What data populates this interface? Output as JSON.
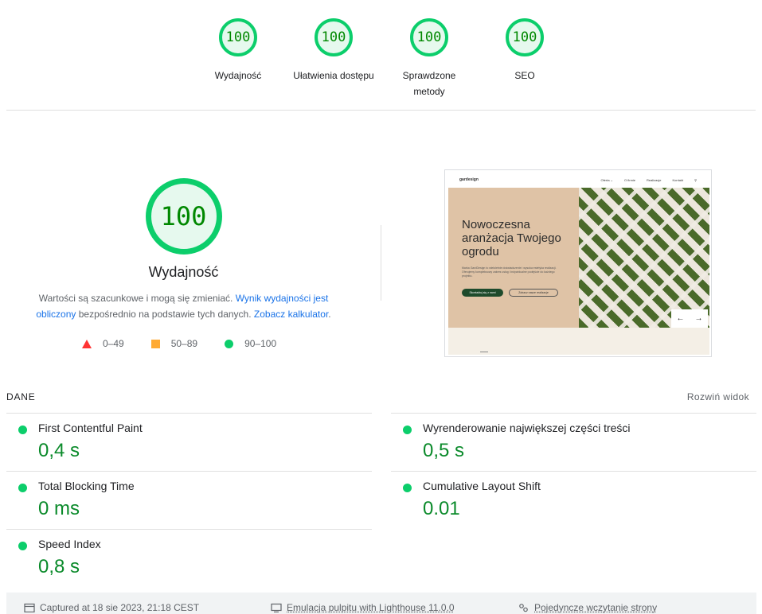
{
  "categories": [
    {
      "score": "100",
      "label": "Wydajność"
    },
    {
      "score": "100",
      "label": "Ułatwienia dostępu"
    },
    {
      "score": "100",
      "label": "Sprawdzone metody"
    },
    {
      "score": "100",
      "label": "SEO"
    }
  ],
  "performance": {
    "score": "100",
    "title": "Wydajność",
    "desc_part1": "Wartości są szacunkowe i mogą się zmieniać. ",
    "desc_link1": "Wynik wydajności jest obliczony",
    "desc_part2": " bezpośrednio na podstawie tych danych. ",
    "desc_link2": "Zobacz kalkulator",
    "desc_part3": "."
  },
  "legend": [
    {
      "shape": "triangle",
      "label": "0–49",
      "color": "#ff3333"
    },
    {
      "shape": "square",
      "label": "50–89",
      "color": "#ffaa33"
    },
    {
      "shape": "circle",
      "label": "90–100",
      "color": "#0cce6b"
    }
  ],
  "preview": {
    "logo": "gardesign",
    "menu": [
      "Oferta ⌄",
      "O firmie",
      "Realizacje",
      "Kontakt"
    ],
    "headline": "Nowoczesna aranżacja Twojego ogrodu",
    "paragraph": "Marka GardDesign to wieloletnie doświadczenie i wysoka estetyka realizacji. Oferujemy kompleksowy zakres usług i indywidualne podejście do każdego projektu.",
    "btn_primary": "Skontaktuj się z nami",
    "btn_secondary": "Zobacz nasze realizacje"
  },
  "metrics_section": {
    "title": "DANE",
    "expand_label": "Rozwiń widok"
  },
  "metrics": [
    {
      "name": "First Contentful Paint",
      "value": "0,4 s"
    },
    {
      "name": "Wyrenderowanie największej części treści",
      "value": "0,5 s"
    },
    {
      "name": "Total Blocking Time",
      "value": "0 ms"
    },
    {
      "name": "Cumulative Layout Shift",
      "value": "0.01"
    },
    {
      "name": "Speed Index",
      "value": "0,8 s"
    }
  ],
  "footer": {
    "captured": "Captured at 18 sie 2023, 21:18 CEST",
    "emulation": "Emulacja pulpitu with Lighthouse 11.0.0",
    "load": "Pojedyncze wczytanie strony"
  },
  "colors": {
    "pass": "#0cce6b",
    "pass_text": "#008800",
    "link": "#1a73e8"
  }
}
